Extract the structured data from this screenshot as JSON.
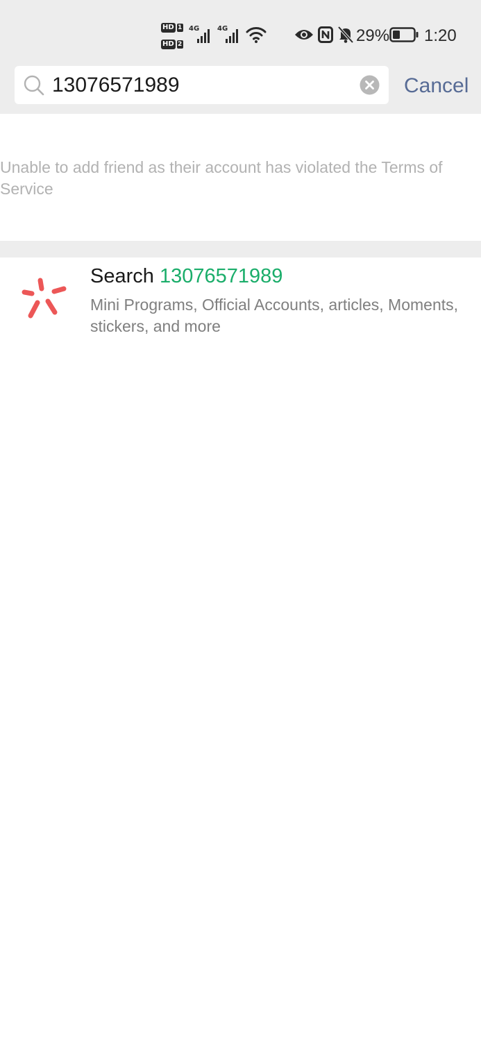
{
  "status_bar": {
    "sim1_label": "HD",
    "sim1_number": "1",
    "sim2_label": "HD",
    "sim2_number": "2",
    "network1": "4G",
    "network2": "4G",
    "battery_percent": "29%",
    "time": "1:20",
    "icons": [
      "wifi-icon",
      "eye-icon",
      "nfc-icon",
      "bell-off-icon",
      "battery-icon"
    ]
  },
  "search": {
    "value": "13076571989",
    "cancel_label": "Cancel",
    "icon": "search-icon",
    "clear_icon": "clear-icon"
  },
  "notice": {
    "text": "Unable to add friend as their account has violated the Terms of Service"
  },
  "search_result": {
    "prefix": "Search",
    "keyword": "13076571989",
    "description": "Mini Programs, Official Accounts, articles, Moments, stickers, and more",
    "icon": "search-logo-icon"
  },
  "colors": {
    "accent_green": "#1aad6a",
    "link_blue": "#576b95",
    "logo_red": "#ec5757",
    "background_gray": "#ededed",
    "notice_gray": "#b2b2b2"
  }
}
